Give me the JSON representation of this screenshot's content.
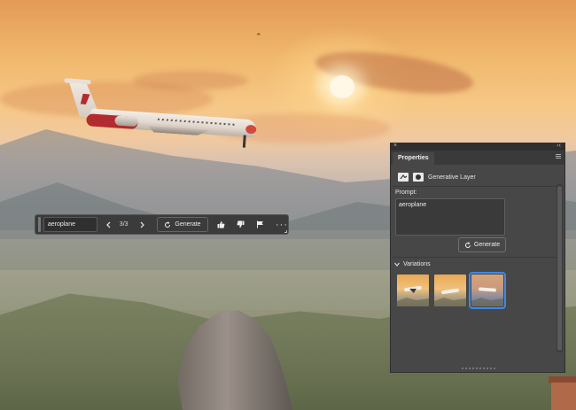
{
  "taskbar": {
    "prompt_value": "aeroplane",
    "variation_counter": "3/3",
    "generate_label": "Generate",
    "more_label": "···"
  },
  "panel": {
    "tab_title": "Properties",
    "layer_type": "Generative Layer",
    "prompt_label": "Prompt:",
    "prompt_value": "aeroplane",
    "generate_label": "Generate",
    "variations_label": "Variations",
    "variations": [
      {
        "selected": false
      },
      {
        "selected": false
      },
      {
        "selected": true
      }
    ]
  },
  "icons": {
    "prev": "chevron-left-icon",
    "next": "chevron-right-icon",
    "generate": "regenerate-icon",
    "like": "thumbs-up-icon",
    "dislike": "thumbs-down-icon",
    "report": "flag-icon",
    "more": "more-horizontal-icon"
  },
  "colors": {
    "accent": "#3c8ae6",
    "panel_bg": "#474747",
    "taskbar_bg": "#3b3b3b"
  }
}
